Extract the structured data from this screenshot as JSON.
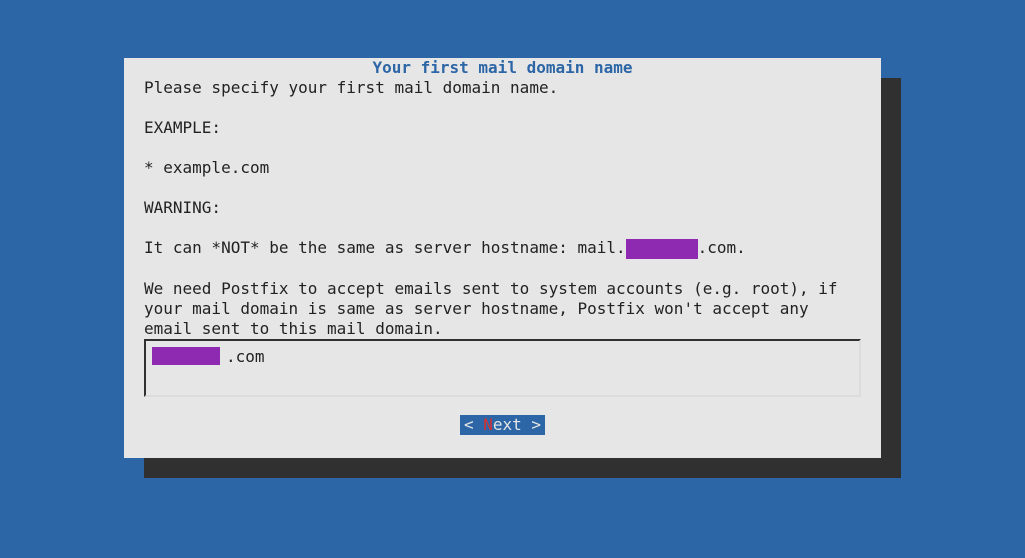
{
  "dialog": {
    "title": "Your first mail domain name",
    "line1": "Please specify your first mail domain name.",
    "example_label": "EXAMPLE:",
    "example_value": "* example.com",
    "warning_label": "WARNING:",
    "warning_line": "It can *NOT* be the same as server hostname: mail.",
    "warning_suffix": ".com.",
    "info1": "We need Postfix to accept emails sent to system accounts (e.g. root), if",
    "info2": "your mail domain is same as server hostname, Postfix won't accept any",
    "info3": "email sent to this mail domain.",
    "input_value": ".com",
    "button_prefix": "< ",
    "button_hotkey": "N",
    "button_rest": "ext >"
  }
}
